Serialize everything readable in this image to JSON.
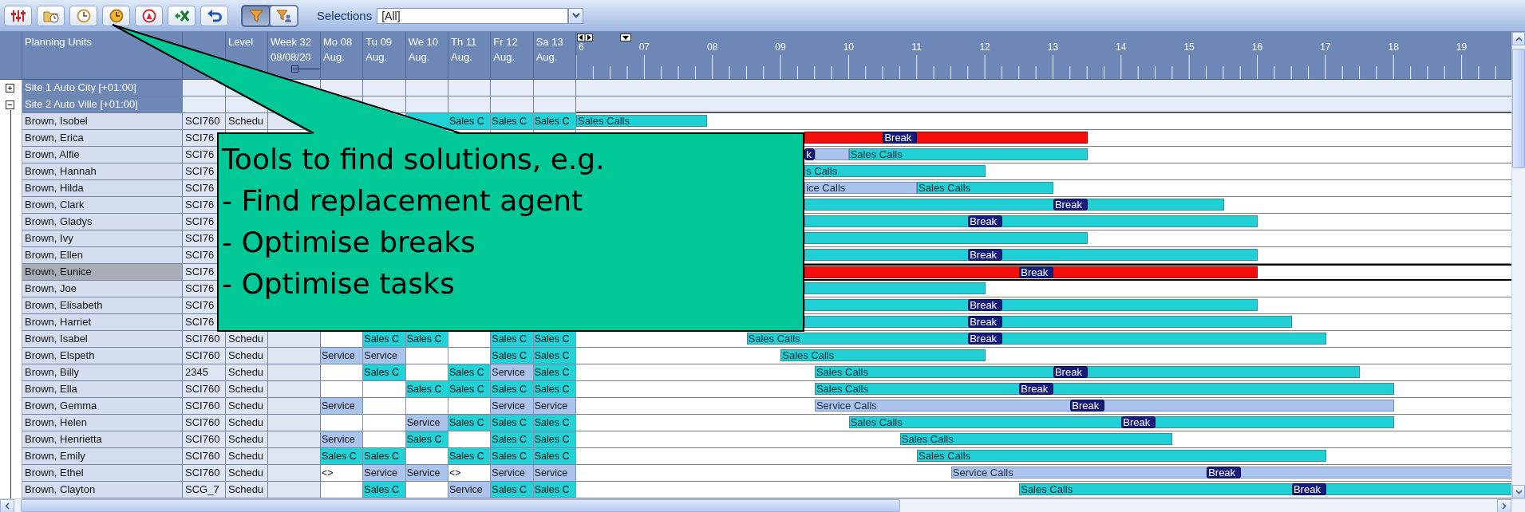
{
  "toolbar": {
    "buttons": [
      {
        "kind": "sliders"
      },
      {
        "kind": "folder_clock"
      },
      {
        "kind": "clock"
      },
      {
        "kind": "clock_gold"
      },
      {
        "kind": "ring"
      },
      {
        "kind": "spreadsheet"
      },
      {
        "kind": "undo"
      }
    ],
    "toggles": [
      {
        "kind": "filter",
        "selected": true
      },
      {
        "kind": "filter_user",
        "selected": false
      }
    ],
    "selections": {
      "label": "Selections",
      "value": "[All]"
    }
  },
  "grid": {
    "columns": {
      "name": "Planning Units",
      "level": "Level",
      "week": [
        "Week 32",
        "08/08/20"
      ],
      "days": [
        [
          "Mo 08",
          "Aug."
        ],
        [
          "Tu 09",
          "Aug."
        ],
        [
          "We 10",
          "Aug."
        ],
        [
          "Th 11",
          "Aug."
        ],
        [
          "Fr 12",
          "Aug."
        ],
        [
          "Sa 13",
          "Aug."
        ]
      ]
    },
    "hours": [
      "6",
      "07",
      "08",
      "09",
      "10",
      "11",
      "12",
      "13",
      "14",
      "15",
      "16",
      "17",
      "18",
      "19"
    ],
    "sites": [
      {
        "label": "Site 1 Auto City [+01:00]",
        "expanded": false
      },
      {
        "label": "Site 2 Auto Ville [+01:00]",
        "expanded": true,
        "rows": [
          {
            "name": "Brown, Isobel",
            "code": "SCI760",
            "level": "Schedu",
            "selected": false,
            "days": [
              {
                "kind": "sales"
              },
              {
                "kind": "sales",
                "text": "Sales C"
              },
              {
                "kind": "sales",
                "text": "Sales C"
              },
              {
                "kind": "sales",
                "text": "Sales C"
              }
            ],
            "bars": [
              {
                "kind": "sales",
                "label": "Sales Calls"
              }
            ]
          },
          {
            "name": "Brown, Erica",
            "code": "SCI76",
            "selected": false,
            "bars": [
              {
                "kind": "conflict"
              },
              {
                "kind": "break",
                "label": "Break"
              }
            ]
          },
          {
            "name": "Brown, Alfie",
            "code": "SCI76",
            "selected": false,
            "bars": [
              {
                "kind": "break",
                "label": "k"
              },
              {
                "kind": "service"
              },
              {
                "kind": "sales",
                "label": "Sales Calls"
              }
            ]
          },
          {
            "name": "Brown, Hannah",
            "code": "SCI76",
            "selected": false,
            "bars": [
              {
                "kind": "sales",
                "label": "s Calls"
              }
            ]
          },
          {
            "name": "Brown, Hilda",
            "code": "SCI76",
            "selected": false,
            "bars": [
              {
                "kind": "service",
                "label": "ice Calls"
              },
              {
                "kind": "sales",
                "label": "Sales Calls"
              }
            ]
          },
          {
            "name": "Brown, Clark",
            "code": "SCI76",
            "selected": false,
            "bars": [
              {
                "kind": "sales"
              },
              {
                "kind": "break",
                "label": "Break"
              }
            ]
          },
          {
            "name": "Brown, Gladys",
            "code": "SCI76",
            "selected": false,
            "bars": [
              {
                "kind": "sales"
              },
              {
                "kind": "break",
                "label": "Break"
              }
            ]
          },
          {
            "name": "Brown, Ivy",
            "code": "SCI76",
            "selected": false,
            "bars": [
              {
                "kind": "sales"
              }
            ]
          },
          {
            "name": "Brown, Ellen",
            "code": "SCI76",
            "selected": false,
            "bars": [
              {
                "kind": "sales"
              },
              {
                "kind": "break",
                "label": "Break"
              }
            ]
          },
          {
            "name": "Brown, Eunice",
            "code": "SCI76",
            "selected": true,
            "bars": [
              {
                "kind": "conflict"
              },
              {
                "kind": "break",
                "label": "Break"
              }
            ]
          },
          {
            "name": "Brown, Joe",
            "code": "SCI76",
            "selected": false,
            "bars": [
              {
                "kind": "sales"
              }
            ]
          },
          {
            "name": "Brown, Elisabeth",
            "code": "SCI76",
            "selected": false,
            "bars": [
              {
                "kind": "sales"
              },
              {
                "kind": "break",
                "label": "Break"
              }
            ]
          },
          {
            "name": "Brown, Harriet",
            "code": "SCI76",
            "selected": false,
            "bars": [
              {
                "kind": "sales"
              },
              {
                "kind": "break",
                "label": "Break"
              }
            ]
          },
          {
            "name": "Brown, Isabel",
            "code": "SCI760",
            "level": "Schedu",
            "selected": false,
            "days": [
              {
                "kind": "empty"
              },
              {
                "kind": "sales",
                "text": "Sales C"
              },
              {
                "kind": "sales",
                "text": "Sales C"
              },
              {
                "kind": "empty"
              },
              {
                "kind": "sales",
                "text": "Sales C"
              },
              {
                "kind": "sales",
                "text": "Sales C"
              }
            ],
            "bars": [
              {
                "kind": "sales",
                "label": "Sales Calls"
              },
              {
                "kind": "break",
                "label": "Break"
              }
            ]
          },
          {
            "name": "Brown, Elspeth",
            "code": "SCI760",
            "level": "Schedu",
            "selected": false,
            "days": [
              {
                "kind": "service",
                "text": "Service"
              },
              {
                "kind": "service",
                "text": "Service"
              },
              {
                "kind": "empty"
              },
              {
                "kind": "empty"
              },
              {
                "kind": "sales",
                "text": "Sales C"
              },
              {
                "kind": "sales",
                "text": "Sales C"
              }
            ],
            "bars": [
              {
                "kind": "sales",
                "label": "Sales Calls"
              }
            ]
          },
          {
            "name": "Brown, Billy",
            "code": "2345",
            "level": "Schedu",
            "selected": false,
            "days": [
              {
                "kind": "empty"
              },
              {
                "kind": "sales",
                "text": "Sales C"
              },
              {
                "kind": "empty"
              },
              {
                "kind": "sales",
                "text": "Sales C"
              },
              {
                "kind": "service",
                "text": "Service"
              },
              {
                "kind": "sales",
                "text": "Sales C"
              }
            ],
            "bars": [
              {
                "kind": "sales",
                "label": "Sales Calls"
              },
              {
                "kind": "break",
                "label": "Break"
              }
            ]
          },
          {
            "name": "Brown, Ella",
            "code": "SCI760",
            "level": "Schedu",
            "selected": false,
            "days": [
              {
                "kind": "empty"
              },
              {
                "kind": "empty"
              },
              {
                "kind": "sales",
                "text": "Sales C"
              },
              {
                "kind": "sales",
                "text": "Sales C"
              },
              {
                "kind": "sales",
                "text": "Sales C"
              },
              {
                "kind": "sales",
                "text": "Sales C"
              }
            ],
            "bars": [
              {
                "kind": "sales",
                "label": "Sales Calls"
              },
              {
                "kind": "break",
                "label": "Break"
              }
            ]
          },
          {
            "name": "Brown, Gemma",
            "code": "SCI760",
            "level": "Schedu",
            "selected": false,
            "days": [
              {
                "kind": "service",
                "text": "Service"
              },
              {
                "kind": "empty"
              },
              {
                "kind": "empty"
              },
              {
                "kind": "empty"
              },
              {
                "kind": "service",
                "text": "Service"
              },
              {
                "kind": "service",
                "text": "Service"
              }
            ],
            "bars": [
              {
                "kind": "service",
                "label": "Service Calls"
              },
              {
                "kind": "break",
                "label": "Break"
              }
            ]
          },
          {
            "name": "Brown, Helen",
            "code": "SCI760",
            "level": "Schedu",
            "selected": false,
            "days": [
              {
                "kind": "empty"
              },
              {
                "kind": "empty"
              },
              {
                "kind": "service",
                "text": "Service"
              },
              {
                "kind": "sales",
                "text": "Sales C"
              },
              {
                "kind": "sales",
                "text": "Sales C"
              },
              {
                "kind": "sales",
                "text": "Sales C"
              }
            ],
            "bars": [
              {
                "kind": "sales",
                "label": "Sales Calls"
              },
              {
                "kind": "break",
                "label": "Break"
              }
            ]
          },
          {
            "name": "Brown, Henrietta",
            "code": "SCI760",
            "level": "Schedu",
            "selected": false,
            "days": [
              {
                "kind": "service",
                "text": "Service"
              },
              {
                "kind": "empty"
              },
              {
                "kind": "sales",
                "text": "Sales C"
              },
              {
                "kind": "empty"
              },
              {
                "kind": "sales",
                "text": "Sales C"
              },
              {
                "kind": "sales",
                "text": "Sales C"
              }
            ],
            "bars": [
              {
                "kind": "sales",
                "label": "Sales Calls"
              }
            ]
          },
          {
            "name": "Brown, Emily",
            "code": "SCI760",
            "level": "Schedu",
            "selected": false,
            "days": [
              {
                "kind": "sales",
                "text": "Sales C"
              },
              {
                "kind": "sales",
                "text": "Sales C"
              },
              {
                "kind": "empty"
              },
              {
                "kind": "sales",
                "text": "Sales C"
              },
              {
                "kind": "sales",
                "text": "Sales C"
              },
              {
                "kind": "sales",
                "text": "Sales C"
              }
            ],
            "bars": [
              {
                "kind": "sales",
                "label": "Sales Calls"
              }
            ]
          },
          {
            "name": "Brown, Ethel",
            "code": "SCI760",
            "level": "Schedu",
            "selected": false,
            "days": [
              {
                "kind": "open",
                "text": "<>"
              },
              {
                "kind": "service",
                "text": "Service"
              },
              {
                "kind": "service",
                "text": "Service"
              },
              {
                "kind": "open",
                "text": "<>"
              },
              {
                "kind": "service",
                "text": "Service"
              },
              {
                "kind": "service",
                "text": "Service"
              }
            ],
            "bars": [
              {
                "kind": "service",
                "label": "Service Calls"
              },
              {
                "kind": "break",
                "label": "Break"
              }
            ]
          },
          {
            "name": "Brown, Clayton",
            "code": "SCG_7",
            "level": "Schedu",
            "selected": false,
            "days": [
              {
                "kind": "empty"
              },
              {
                "kind": "sales",
                "text": "Sales C"
              },
              {
                "kind": "empty"
              },
              {
                "kind": "service",
                "text": "Service"
              },
              {
                "kind": "sales",
                "text": "Sales C"
              },
              {
                "kind": "sales",
                "text": "Sales C"
              }
            ],
            "bars": [
              {
                "kind": "sales",
                "label": "Sales Calls"
              },
              {
                "kind": "break",
                "label": "Break"
              }
            ]
          }
        ]
      }
    ]
  },
  "callout": {
    "lines": [
      "Tools to find solutions, e.g.",
      "- Find replacement agent",
      "- Optimise breaks",
      "- Optimise tasks"
    ]
  }
}
